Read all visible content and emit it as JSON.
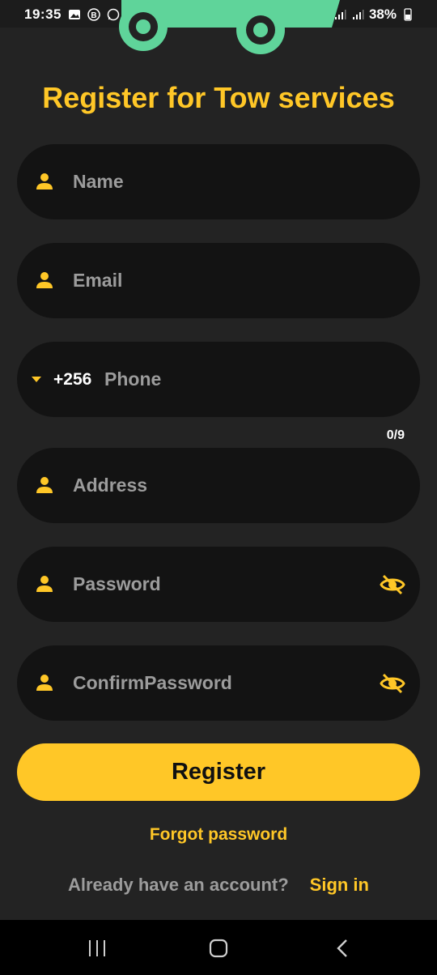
{
  "status_bar": {
    "time": "19:35",
    "battery": "38%"
  },
  "title": "Register for Tow services",
  "form": {
    "name_placeholder": "Name",
    "email_placeholder": "Email",
    "phone_code": "+256",
    "phone_placeholder": "Phone",
    "phone_counter": "0/9",
    "address_placeholder": "Address",
    "password_placeholder": "Password",
    "confirm_password_placeholder": "ConfirmPassword"
  },
  "actions": {
    "register_label": "Register",
    "forgot_password_label": "Forgot password",
    "account_question": "Already have an account?",
    "sign_in_label": "Sign in"
  },
  "colors": {
    "accent": "#ffc727",
    "background": "#232323",
    "field_background": "#131313",
    "car_green": "#5fd49a"
  },
  "icons": [
    "person-icon",
    "eye-off-icon",
    "dropdown-arrow-icon",
    "recents-icon",
    "home-icon",
    "back-icon"
  ]
}
